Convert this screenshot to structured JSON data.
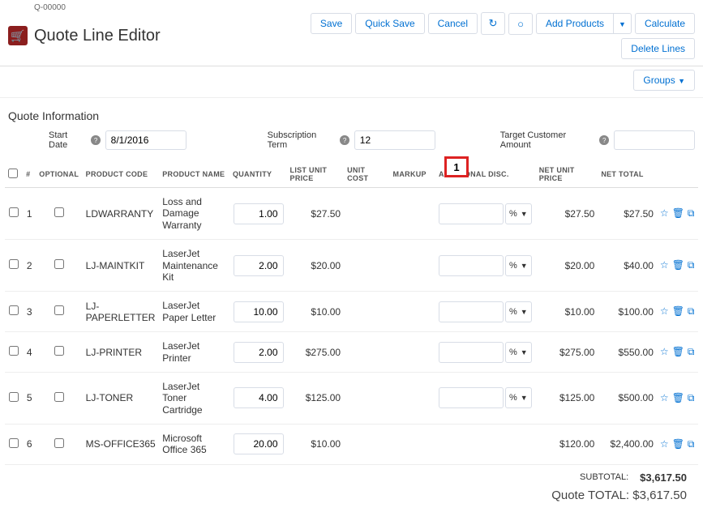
{
  "header": {
    "quote_id": "Q-00000",
    "title": "Quote Line Editor"
  },
  "toolbar": {
    "save": "Save",
    "quick_save": "Quick Save",
    "cancel": "Cancel",
    "add_products": "Add Products",
    "calculate": "Calculate",
    "delete_lines": "Delete Lines",
    "groups": "Groups"
  },
  "section": {
    "quote_info": "Quote Information"
  },
  "fields": {
    "start_date_label": "Start Date",
    "start_date_value": "8/1/2016",
    "sub_term_label": "Subscription Term",
    "sub_term_value": "12",
    "target_amount_label": "Target Customer Amount",
    "target_amount_value": ""
  },
  "columns": {
    "num": "#",
    "optional": "OPTIONAL",
    "product_code": "PRODUCT CODE",
    "product_name": "PRODUCT NAME",
    "quantity": "QUANTITY",
    "list_unit_price": "LIST UNIT PRICE",
    "unit_cost": "UNIT COST",
    "markup": "MARKUP",
    "additional_disc": "ADDITIONAL DISC.",
    "net_unit_price": "NET UNIT PRICE",
    "net_total": "NET TOTAL"
  },
  "callout": {
    "label": "1"
  },
  "discount_unit": "%",
  "rows": [
    {
      "idx": "1",
      "code": "LDWARRANTY",
      "name": "Loss and Damage Warranty",
      "qty": "1.00",
      "list_price": "$27.50",
      "unit_cost": "",
      "markup": "",
      "net_unit_price": "$27.50",
      "net_total": "$27.50",
      "has_disc": true
    },
    {
      "idx": "2",
      "code": "LJ-MAINTKIT",
      "name": "LaserJet Maintenance Kit",
      "qty": "2.00",
      "list_price": "$20.00",
      "unit_cost": "",
      "markup": "",
      "net_unit_price": "$20.00",
      "net_total": "$40.00",
      "has_disc": true
    },
    {
      "idx": "3",
      "code": "LJ-PAPERLETTER",
      "name": "LaserJet Paper Letter",
      "qty": "10.00",
      "list_price": "$10.00",
      "unit_cost": "",
      "markup": "",
      "net_unit_price": "$10.00",
      "net_total": "$100.00",
      "has_disc": true
    },
    {
      "idx": "4",
      "code": "LJ-PRINTER",
      "name": "LaserJet Printer",
      "qty": "2.00",
      "list_price": "$275.00",
      "unit_cost": "",
      "markup": "",
      "net_unit_price": "$275.00",
      "net_total": "$550.00",
      "has_disc": true
    },
    {
      "idx": "5",
      "code": "LJ-TONER",
      "name": "LaserJet Toner Cartridge",
      "qty": "4.00",
      "list_price": "$125.00",
      "unit_cost": "",
      "markup": "",
      "net_unit_price": "$125.00",
      "net_total": "$500.00",
      "has_disc": true
    },
    {
      "idx": "6",
      "code": "MS-OFFICE365",
      "name": "Microsoft Office 365",
      "qty": "20.00",
      "list_price": "$10.00",
      "unit_cost": "",
      "markup": "",
      "net_unit_price": "$120.00",
      "net_total": "$2,400.00",
      "has_disc": false
    }
  ],
  "totals": {
    "subtotal_label": "SUBTOTAL:",
    "subtotal_value": "$3,617.50",
    "quote_total_label": "Quote TOTAL:",
    "quote_total_value": "$3,617.50"
  }
}
